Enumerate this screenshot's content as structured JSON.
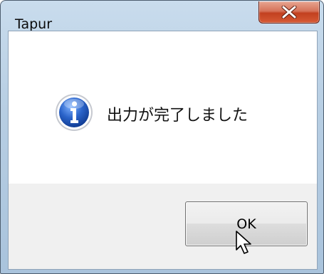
{
  "window": {
    "title": "Tapur",
    "close_icon": "close-icon"
  },
  "dialog": {
    "icon": "information-icon",
    "message": "出力が完了しました",
    "ok_label": "OK"
  },
  "colors": {
    "titlebar": "#b7cee3",
    "close_button": "#c2401f",
    "info_icon": "#1f4fb3",
    "content_bg": "#ffffff",
    "footer_bg": "#f0f0f0"
  },
  "cursor": "arrow-cursor-icon"
}
